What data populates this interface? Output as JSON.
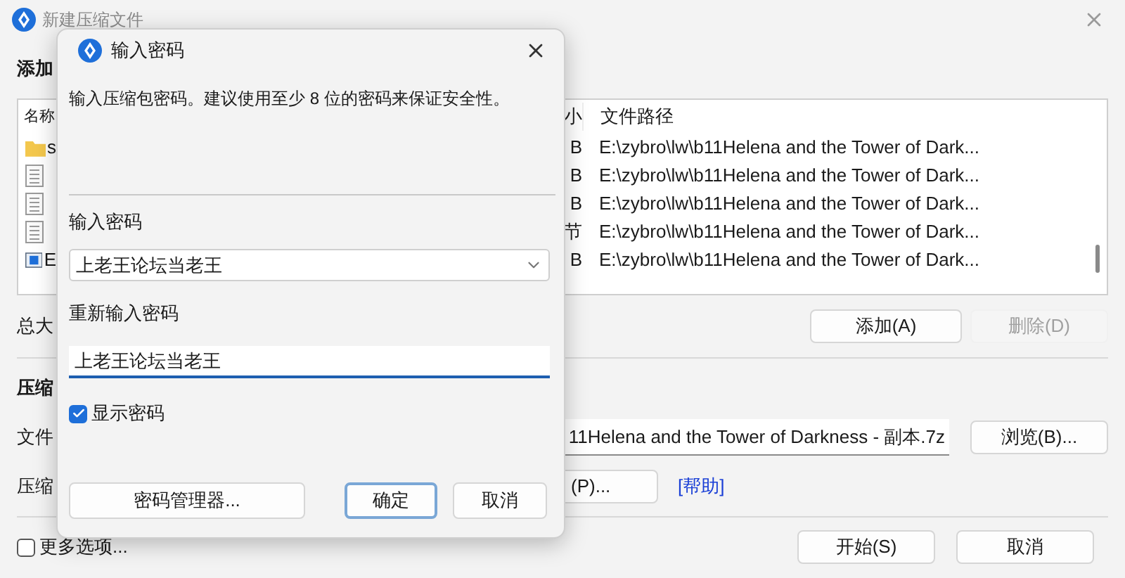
{
  "window": {
    "title": "新建压缩文件"
  },
  "add_section": {
    "heading": "添加"
  },
  "file_list": {
    "columns": [
      "名称",
      "小",
      "文件路径"
    ],
    "rows": [
      {
        "kind": "folder",
        "name": "s",
        "size": "B",
        "path": "E:\\zybro\\lw\\b11Helena and the Tower of Dark..."
      },
      {
        "kind": "file",
        "size": "B",
        "path": "E:\\zybro\\lw\\b11Helena and the Tower of Dark..."
      },
      {
        "kind": "file",
        "size": "B",
        "path": "E:\\zybro\\lw\\b11Helena and the Tower of Dark..."
      },
      {
        "kind": "file",
        "size": "节",
        "path": "E:\\zybro\\lw\\b11Helena and the Tower of Dark..."
      },
      {
        "kind": "program",
        "name": "E",
        "size": "B",
        "path": "E:\\zybro\\lw\\b11Helena and the Tower of Dark..."
      }
    ]
  },
  "total_label": "总大",
  "list_buttons": [
    {
      "label": "添加(A)",
      "disabled": false
    },
    {
      "label": "删除(D)",
      "disabled": true
    }
  ],
  "archive_section": {
    "heading": "压缩",
    "file_label": "文件",
    "file_value": "11Helena and the Tower of Darkness - 副本.7z",
    "browse_button": "浏览(B)...",
    "format_label": "压缩",
    "password_button": "(P)...",
    "help_link": "[帮助]"
  },
  "more_options": {
    "label": "更多选项...",
    "checked": false
  },
  "footer_buttons": [
    "开始(S)",
    "取消"
  ],
  "dialog": {
    "title": "输入密码",
    "description": "输入压缩包密码。建议使用至少 8 位的密码来保证安全性。",
    "password_label": "输入密码",
    "password_value": "上老王论坛当老王",
    "confirm_label": "重新输入密码",
    "confirm_value": "上老王论坛当老王",
    "show_password": {
      "label": "显示密码",
      "checked": true
    },
    "manager_button": "密码管理器...",
    "ok_button": "确定",
    "cancel_button": "取消"
  }
}
